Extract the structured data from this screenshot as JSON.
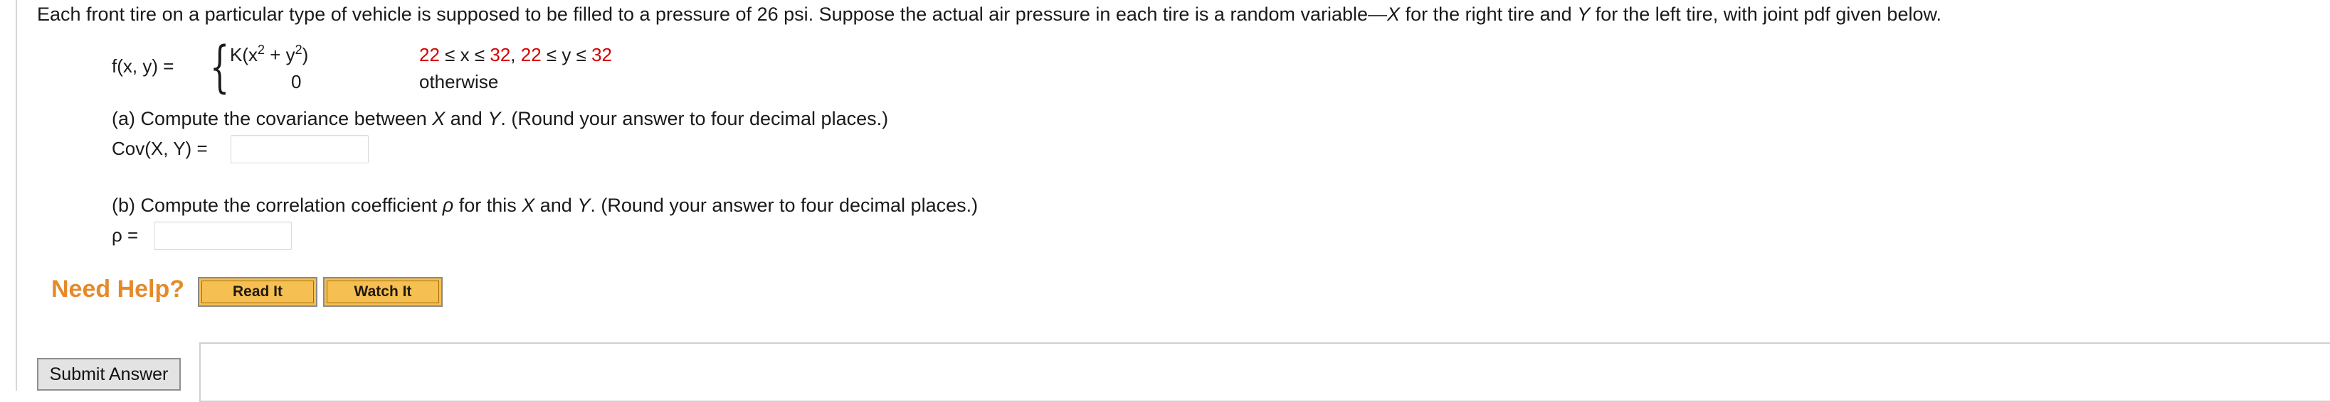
{
  "question": {
    "intro_before_x": "Each front tire on a particular type of vehicle is supposed to be filled to a pressure of 26 psi. Suppose the actual air pressure in each tire is a random variable—",
    "var_x": "X",
    "intro_mid": " for the right tire and ",
    "var_y": "Y",
    "intro_after_y": " for the left tire, with joint pdf given below."
  },
  "pdf": {
    "lhs": "f(x, y) =",
    "case1_expr_pre": "K(x",
    "case1_expr_sup1": "2",
    "case1_expr_mid": " + y",
    "case1_expr_sup2": "2",
    "case1_expr_post": ")",
    "case1_cond_x_low": "22",
    "case1_cond_x_mid": " ≤ x ≤ ",
    "case1_cond_x_high": "32",
    "case1_cond_sep": ", ",
    "case1_cond_y_low": "22",
    "case1_cond_y_mid": " ≤ y ≤ ",
    "case1_cond_y_high": "32",
    "case2_expr": "0",
    "case2_cond": "otherwise"
  },
  "part_a": {
    "prompt_pre": "(a) Compute the covariance between ",
    "var_x": "X",
    "prompt_and": " and ",
    "var_y": "Y",
    "prompt_post": ". (Round your answer to four decimal places.)",
    "answer_label": "Cov(X, Y) =",
    "answer_value": ""
  },
  "part_b": {
    "prompt_pre": "(b) Compute the correlation coefficient ",
    "var_rho": "ρ",
    "prompt_for": " for this ",
    "var_x": "X",
    "prompt_and": " and ",
    "var_y": "Y",
    "prompt_post": ". (Round your answer to four decimal places.)",
    "answer_label": "ρ =",
    "answer_value": ""
  },
  "help": {
    "label": "Need Help?",
    "read_it": "Read It",
    "watch_it": "Watch It"
  },
  "submit": {
    "label": "Submit Answer"
  },
  "colors": {
    "accent_orange": "#e58a2b",
    "button_gold": "#f6bf51",
    "constraint_red": "#d40000"
  }
}
